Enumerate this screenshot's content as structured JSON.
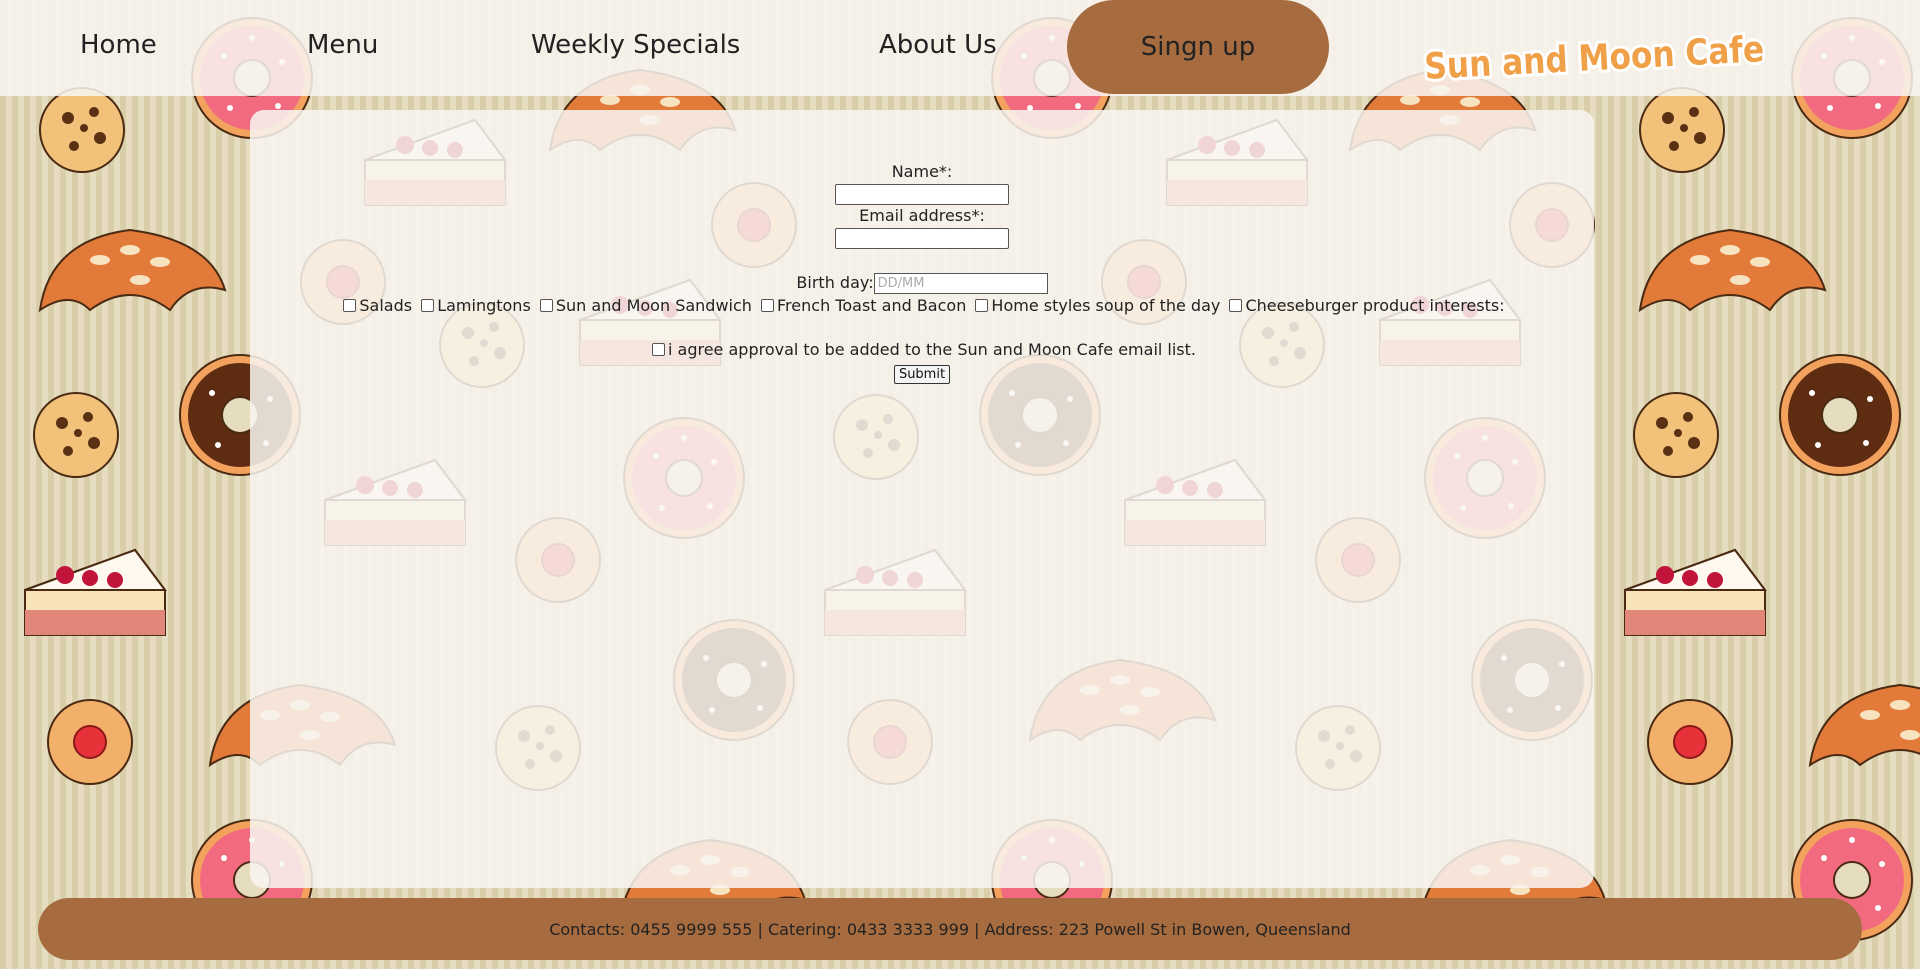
{
  "nav": {
    "items": [
      {
        "label": "Home"
      },
      {
        "label": "Menu"
      },
      {
        "label": "Weekly Specials"
      },
      {
        "label": "About Us"
      }
    ],
    "signup_label": "Singn up",
    "logo_text": "Sun and Moon Cafe"
  },
  "form": {
    "name_label": "Name*:",
    "name_value": "",
    "email_label": "Email address*:",
    "email_value": "",
    "birthday_label": "Birth day:",
    "birthday_placeholder": "DD/MM",
    "interests": [
      {
        "label": "Salads",
        "checked": false
      },
      {
        "label": "Lamingtons",
        "checked": false
      },
      {
        "label": "Sun and Moon Sandwich",
        "checked": false
      },
      {
        "label": "French Toast and Bacon",
        "checked": false
      },
      {
        "label": "Home styles soup of the day",
        "checked": false
      },
      {
        "label": "Cheeseburger product interests:",
        "checked": false
      }
    ],
    "agree_label": "i agree approval to be added to the Sun and Moon Cafe email list.",
    "agree_checked": false,
    "submit_label": "Submit"
  },
  "footer": {
    "text": "Contacts: 0455 9999 555 | Catering: 0433 3333 999 | Address: 223 Powell St in Bowen, Queensland"
  },
  "colors": {
    "brand_brown": "#a66c3f",
    "logo_orange": "#f0a048",
    "panel_bg": "#f8f6f1",
    "stripe_dark": "#d9ceaa",
    "stripe_light": "#e6ddc0"
  }
}
